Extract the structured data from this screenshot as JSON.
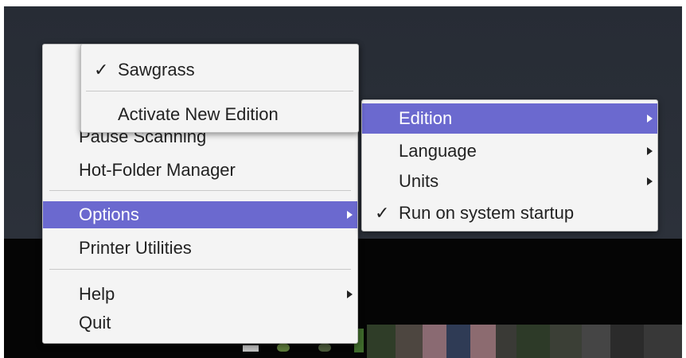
{
  "main_menu": {
    "items": [
      {
        "label": "Pause Scanning"
      },
      {
        "label": "Hot-Folder Manager"
      },
      {
        "label": "Options"
      },
      {
        "label": "Printer Utilities"
      },
      {
        "label": "Help"
      },
      {
        "label": "Quit"
      }
    ]
  },
  "options_submenu": {
    "items": [
      {
        "label": "Edition"
      },
      {
        "label": "Language"
      },
      {
        "label": "Units"
      },
      {
        "label": "Run on system startup",
        "checked": true
      }
    ]
  },
  "edition_submenu": {
    "items": [
      {
        "label": "Sawgrass",
        "checked": true
      },
      {
        "label": "Activate New Edition"
      }
    ]
  },
  "check_glyph": "✓",
  "colors": {
    "highlight": "#6b69cf",
    "menu_bg": "#f4f4f4",
    "desktop_bg": "#2a2f38"
  }
}
